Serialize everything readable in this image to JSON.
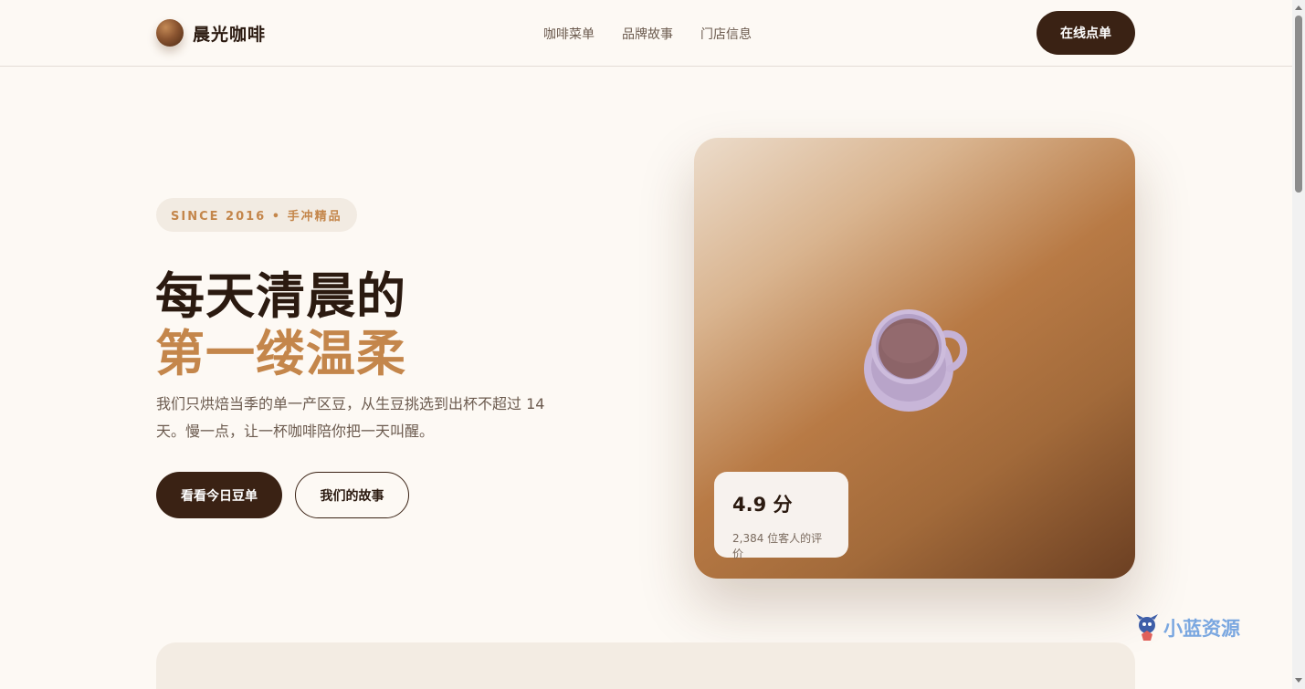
{
  "header": {
    "brand": "晨光咖啡",
    "nav": [
      {
        "label": "咖啡菜单"
      },
      {
        "label": "品牌故事"
      },
      {
        "label": "门店信息"
      }
    ],
    "order_button": "在线点单"
  },
  "hero": {
    "badge": "SINCE 2016 • 手冲精品",
    "title_line1": "每天清晨的",
    "title_line2": "第一缕温柔",
    "description": "我们只烘焙当季的单一产区豆，从生豆挑选到出杯不超过 14 天。慢一点，让一杯咖啡陪你把一天叫醒。",
    "primary_button": "看看今日豆单",
    "secondary_button": "我们的故事",
    "rating": {
      "score": "4.9 分",
      "subtitle": "2,384 位客人的评价"
    }
  },
  "watermark": "小蓝资源",
  "colors": {
    "brand_dark": "#3a2214",
    "accent": "#c4864b",
    "background": "#fdf9f4"
  },
  "icons": [
    "logo-ball-icon",
    "coffee-cup-icon",
    "watermark-mascot-icon"
  ]
}
